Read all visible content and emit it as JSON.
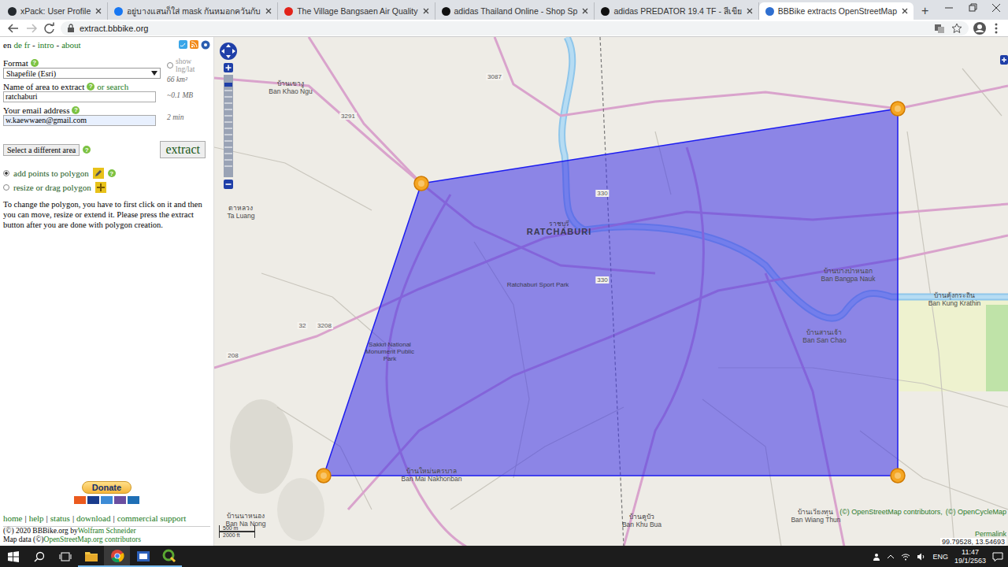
{
  "browser": {
    "tabs": [
      {
        "title": "xPack: User Profile",
        "selected": false,
        "color": "#24292e"
      },
      {
        "title": "อยู่บางแสนก็ใส่ mask กันหมอกควันกับ",
        "selected": false,
        "color": "#1877f2"
      },
      {
        "title": "The Village Bangsaen Air Quality",
        "selected": false,
        "color": "#e2231a"
      },
      {
        "title": "adidas Thailand Online - Shop Sp",
        "selected": false,
        "color": "#111111"
      },
      {
        "title": "adidas PREDATOR 19.4 TF - สีเขีย",
        "selected": false,
        "color": "#111111"
      },
      {
        "title": "BBBike extracts OpenStreetMap",
        "selected": true,
        "color": "#2f6fd0"
      }
    ],
    "new_tab": "+",
    "address": "extract.bbbike.org"
  },
  "page": {
    "languages": [
      {
        "label": "en",
        "selected": true
      },
      {
        "label": "de",
        "selected": false
      },
      {
        "label": "fr",
        "selected": false
      }
    ],
    "separator": "-",
    "nav_links": [
      "intro",
      "about"
    ],
    "help_icon": "?",
    "format": {
      "label": "Format",
      "value": "Shapefile (Esri)"
    },
    "show_lnglat": {
      "label": "show lng/lat",
      "checked": false,
      "disabled": true
    },
    "area_km2": "66 km²",
    "size": "~0.1 MB",
    "time": "2 min",
    "name_field": {
      "label": "Name of area to extract",
      "search_link": "or search",
      "value": "ratchaburi"
    },
    "email_field": {
      "label": "Your email address",
      "value": "w.kaewwaen@gmail.com",
      "autofilled": true
    },
    "select_area_button": "Select a different area",
    "extract_button": "extract",
    "modes": [
      {
        "label": "add points to polygon",
        "selected": true
      },
      {
        "label": "resize or drag polygon",
        "selected": false
      }
    ],
    "instructions": "To change the polygon, you have to first click on it and then you can move, resize or extend it. Please press the extract button after you are done with polygon creation.",
    "donate_button": "Donate",
    "footer_links": [
      "home",
      "help",
      "status",
      "download",
      "commercial support"
    ],
    "footer_separator": "|",
    "copyright": {
      "text": "(©) 2020 BBBike.org by",
      "author": "Wolfram Schneider"
    },
    "map_data": {
      "text": "Map data (©)",
      "link": "OpenStreetMap.org contributors"
    }
  },
  "map": {
    "places": [
      {
        "native": "บ้านเขางู",
        "latin": "Ban Khao Ngu",
        "kind": "village"
      },
      {
        "native": "ตาหลวง",
        "latin": "Ta Luang",
        "kind": "village"
      },
      {
        "native": "ราชบุรี",
        "latin": "RATCHABURI",
        "kind": "city"
      },
      {
        "native": "บ้านบางป่าหนอก",
        "latin": "Ban Bangpa Nauk",
        "kind": "village"
      },
      {
        "native": "บ้านคุ้งกระถิน",
        "latin": "Ban Kung Krathin",
        "kind": "village"
      },
      {
        "native": "บ้านสานเจ้า",
        "latin": "Ban San Chao",
        "kind": "village"
      },
      {
        "native": "บ้านใหม่นครบาล",
        "latin": "Ban Mai Nakhonban",
        "kind": "village"
      },
      {
        "native": "บ้านนาหนอง",
        "latin": "Ban Na Nong",
        "kind": "village"
      },
      {
        "native": "บ้านคูบัว",
        "latin": "Ban Khu Bua",
        "kind": "village"
      },
      {
        "native": "บ้านเวียงทุน",
        "latin": "Ban Wiang Thun",
        "kind": "village"
      }
    ],
    "pois": [
      "Ratchaburi Sport Park",
      "Sakkri National Monument Public Park"
    ],
    "road_refs": [
      "3087",
      "3291",
      "3208",
      "32",
      "208",
      "330",
      "330"
    ],
    "scale": {
      "metric": "500 m",
      "imperial": "2000 ft"
    },
    "attribution": [
      "(©) OpenStreetMap contributors,",
      "(©) OpenCycleMap"
    ],
    "permalink": "Permalink",
    "coordinates": "99.79528, 13.54693"
  },
  "taskbar": {
    "apps": [
      {
        "running": true,
        "selected": false
      },
      {
        "running": true,
        "selected": true
      },
      {
        "running": true,
        "selected": false
      },
      {
        "running": true,
        "selected": false
      }
    ],
    "language": "ENG",
    "time": "11:47",
    "date": "19/1/2563"
  }
}
